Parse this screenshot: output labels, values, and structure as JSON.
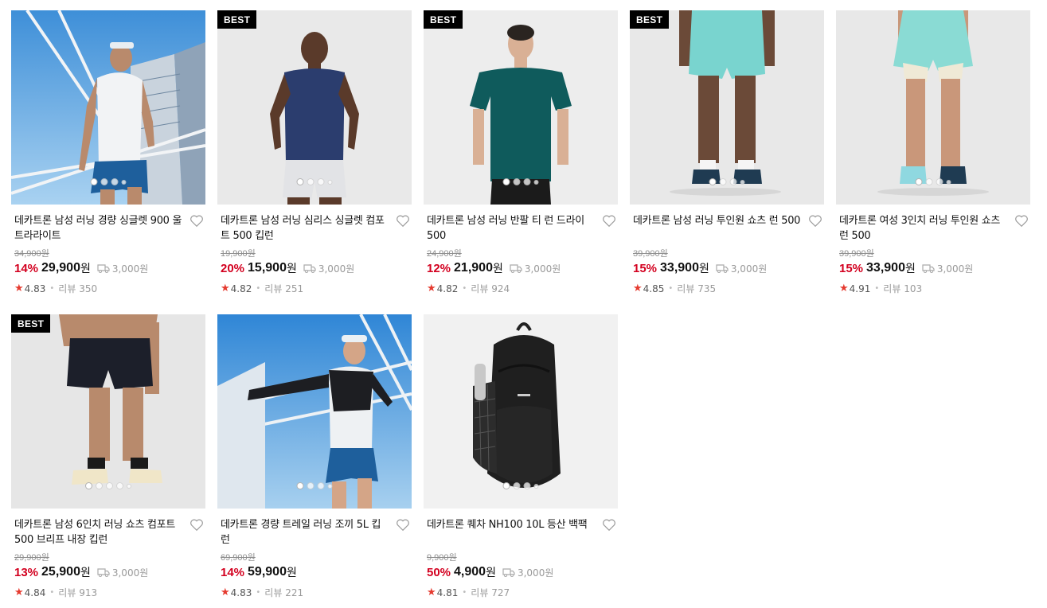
{
  "products": [
    {
      "badge": "",
      "title": "데카트론 남성 러닝 경량 싱글렛 900 울트라라이트",
      "original_price": "34,900원",
      "discount": "14%",
      "price": "29,900",
      "currency": "원",
      "shipping": "3,000원",
      "rating": "4.83",
      "review_label": "리뷰",
      "review_count": "350",
      "image_dots": 4,
      "icon": "heart-icon",
      "scene": "runner-outdoor-singlet"
    },
    {
      "badge": "BEST",
      "title": "데카트론 남성 러닝 심리스 싱글렛 컴포트 500 킵런",
      "original_price": "19,900원",
      "discount": "20%",
      "price": "15,900",
      "currency": "원",
      "shipping": "3,000원",
      "rating": "4.82",
      "review_label": "리뷰",
      "review_count": "251",
      "image_dots": 4,
      "icon": "heart-icon",
      "scene": "navy-singlet"
    },
    {
      "badge": "BEST",
      "title": "데카트론 남성 러닝 반팔 티 런 드라이 500",
      "original_price": "24,900원",
      "discount": "12%",
      "price": "21,900",
      "currency": "원",
      "shipping": "3,000원",
      "rating": "4.82",
      "review_label": "리뷰",
      "review_count": "924",
      "image_dots": 4,
      "icon": "heart-icon",
      "scene": "teal-tee"
    },
    {
      "badge": "BEST",
      "title": "데카트론 남성 러닝 투인원 쇼츠 런 500",
      "original_price": "39,900원",
      "discount": "15%",
      "price": "33,900",
      "currency": "원",
      "shipping": "3,000원",
      "rating": "4.85",
      "review_label": "리뷰",
      "review_count": "735",
      "image_dots": 4,
      "icon": "heart-icon",
      "scene": "mint-shorts-men"
    },
    {
      "badge": "",
      "title": "데카트론 여성 3인치 러닝 투인원 쇼츠 런 500",
      "original_price": "39,900원",
      "discount": "15%",
      "price": "33,900",
      "currency": "원",
      "shipping": "3,000원",
      "rating": "4.91",
      "review_label": "리뷰",
      "review_count": "103",
      "image_dots": 4,
      "icon": "heart-icon",
      "scene": "mint-shorts-women"
    },
    {
      "badge": "BEST",
      "title": "데카트론 남성 6인치 러닝 쇼츠 컴포트 500 브리프 내장 킵런",
      "original_price": "29,900원",
      "discount": "13%",
      "price": "25,900",
      "currency": "원",
      "shipping": "3,000원",
      "rating": "4.84",
      "review_label": "리뷰",
      "review_count": "913",
      "image_dots": 5,
      "icon": "heart-icon",
      "scene": "black-shorts"
    },
    {
      "badge": "",
      "title": "데카트론 경량 트레일 러닝 조끼 5L 킵런",
      "original_price": "69,900원",
      "discount": "14%",
      "price": "59,900",
      "currency": "원",
      "shipping": "",
      "rating": "4.83",
      "review_label": "리뷰",
      "review_count": "221",
      "image_dots": 4,
      "icon": "heart-icon",
      "scene": "trail-vest"
    },
    {
      "badge": "",
      "title": "데카트론 퀘차 NH100 10L 등산 백팩",
      "original_price": "9,900원",
      "discount": "50%",
      "price": "4,900",
      "currency": "원",
      "shipping": "3,000원",
      "rating": "4.81",
      "review_label": "리뷰",
      "review_count": "727",
      "image_dots": 4,
      "icon": "heart-icon",
      "scene": "backpack"
    }
  ],
  "colors": {
    "discount": "#d3001f",
    "star": "#e53a2f",
    "badge_bg": "#000000",
    "muted": "#8e8e8e"
  }
}
